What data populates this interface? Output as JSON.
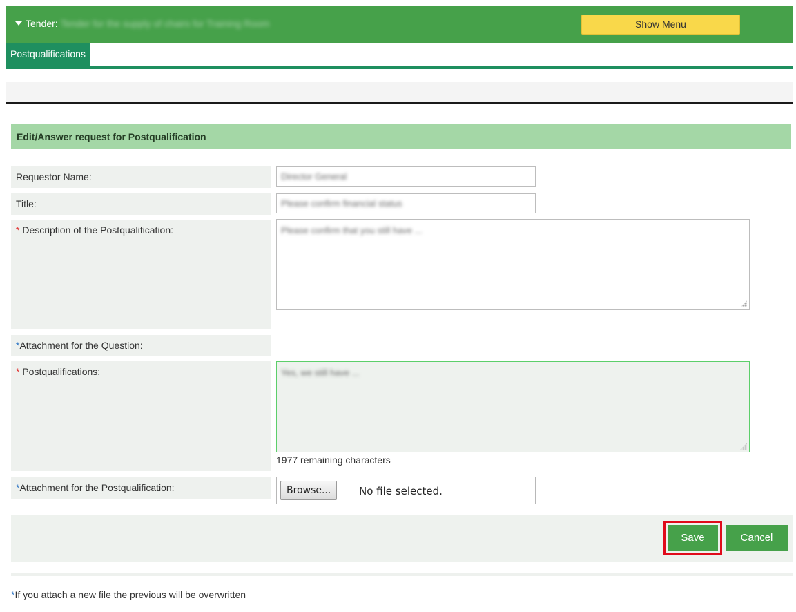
{
  "header": {
    "tender_prefix": "Tender:",
    "tender_name": "Tender for the supply of chairs for Training Room",
    "show_menu_label": "Show Menu"
  },
  "tabs": [
    {
      "label": "Postqualifications",
      "active": true
    }
  ],
  "section": {
    "title": "Edit/Answer request for Postqualification"
  },
  "form": {
    "requestor_label": "Requestor Name:",
    "requestor_value": "Director General",
    "title_label": "Title:",
    "title_value": "Please confirm financial status",
    "description_star": "*",
    "description_label": "Description of the Postqualification:",
    "description_value": "Please confirm that you still have ...",
    "question_attachment_star": "*",
    "question_attachment_label": "Attachment for the Question:",
    "postqual_star": "*",
    "postqual_label": "Postqualifications:",
    "postqual_value": "Yes, we still have ...",
    "remaining_chars": "1977 remaining characters",
    "pq_attachment_star": "*",
    "pq_attachment_label": "Attachment for the Postqualification:",
    "browse_label": "Browse...",
    "no_file_label": "No file selected."
  },
  "actions": {
    "save_label": "Save",
    "cancel_label": "Cancel"
  },
  "footer": {
    "star": "*",
    "note": "If you attach a new file the previous will be overwritten"
  },
  "colors": {
    "header_green": "#46a14a",
    "tab_green": "#1e8f5f",
    "section_green": "#a4d7a6",
    "show_menu_yellow": "#f9d84a",
    "highlight_red": "#e00b1b",
    "required_red": "#e0201f"
  }
}
